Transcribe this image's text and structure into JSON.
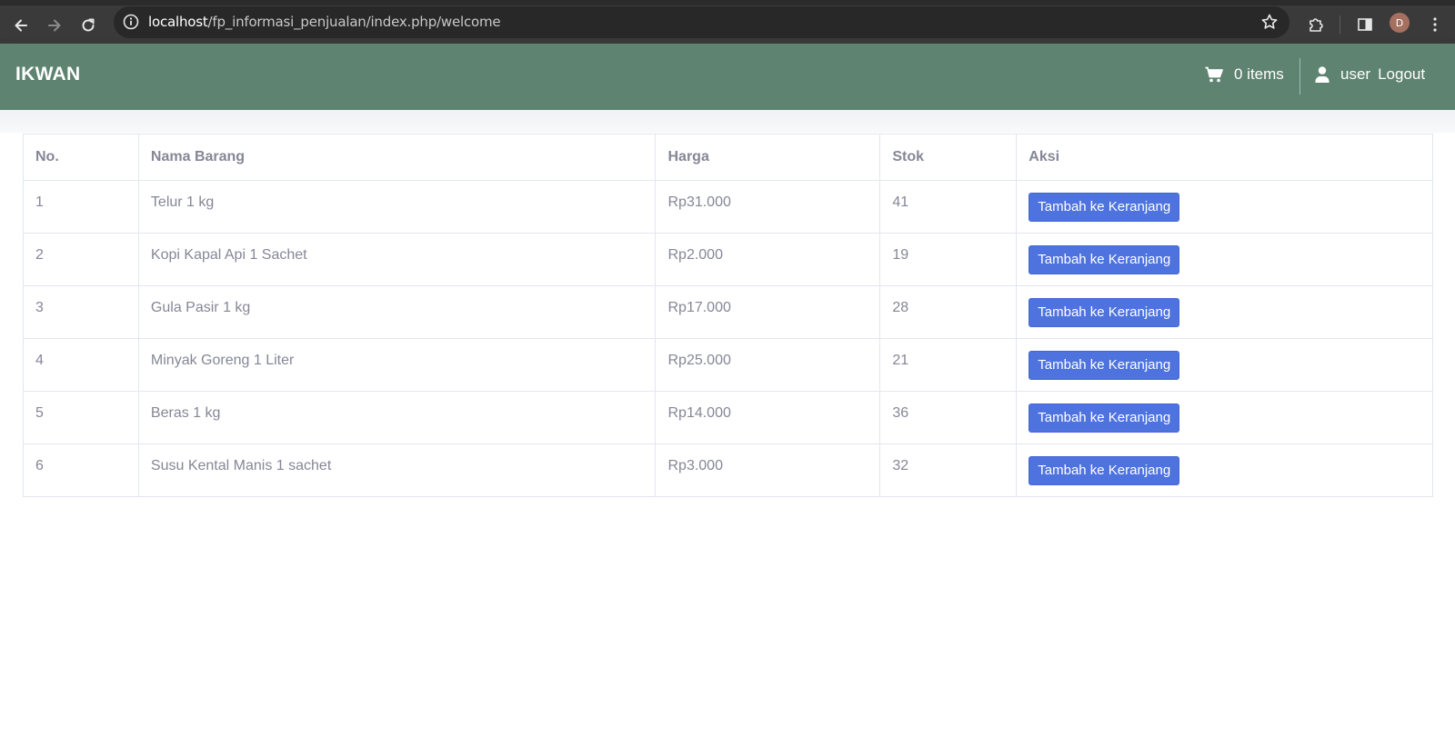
{
  "browser": {
    "url_host": "localhost",
    "url_path": "/fp_informasi_penjualan/index.php/welcome",
    "profile_initial": "D"
  },
  "navbar": {
    "brand": "IKWAN",
    "cart_label": "0 items",
    "user_label": "user",
    "logout_label": "Logout"
  },
  "table": {
    "headers": [
      "No.",
      "Nama Barang",
      "Harga",
      "Stok",
      "Aksi"
    ],
    "rows": [
      {
        "no": "1",
        "nama": "Telur 1 kg",
        "harga": "Rp31.000",
        "stok": "41",
        "aksi": "Tambah ke Keranjang"
      },
      {
        "no": "2",
        "nama": "Kopi Kapal Api 1 Sachet",
        "harga": "Rp2.000",
        "stok": "19",
        "aksi": "Tambah ke Keranjang"
      },
      {
        "no": "3",
        "nama": "Gula Pasir 1 kg",
        "harga": "Rp17.000",
        "stok": "28",
        "aksi": "Tambah ke Keranjang"
      },
      {
        "no": "4",
        "nama": "Minyak Goreng 1 Liter",
        "harga": "Rp25.000",
        "stok": "21",
        "aksi": "Tambah ke Keranjang"
      },
      {
        "no": "5",
        "nama": "Beras 1 kg",
        "harga": "Rp14.000",
        "stok": "36",
        "aksi": "Tambah ke Keranjang"
      },
      {
        "no": "6",
        "nama": "Susu Kental Manis 1 sachet",
        "harga": "Rp3.000",
        "stok": "32",
        "aksi": "Tambah ke Keranjang"
      }
    ]
  },
  "colors": {
    "navbar": "#5e8371",
    "button": "#4e73df",
    "text": "#858796"
  }
}
